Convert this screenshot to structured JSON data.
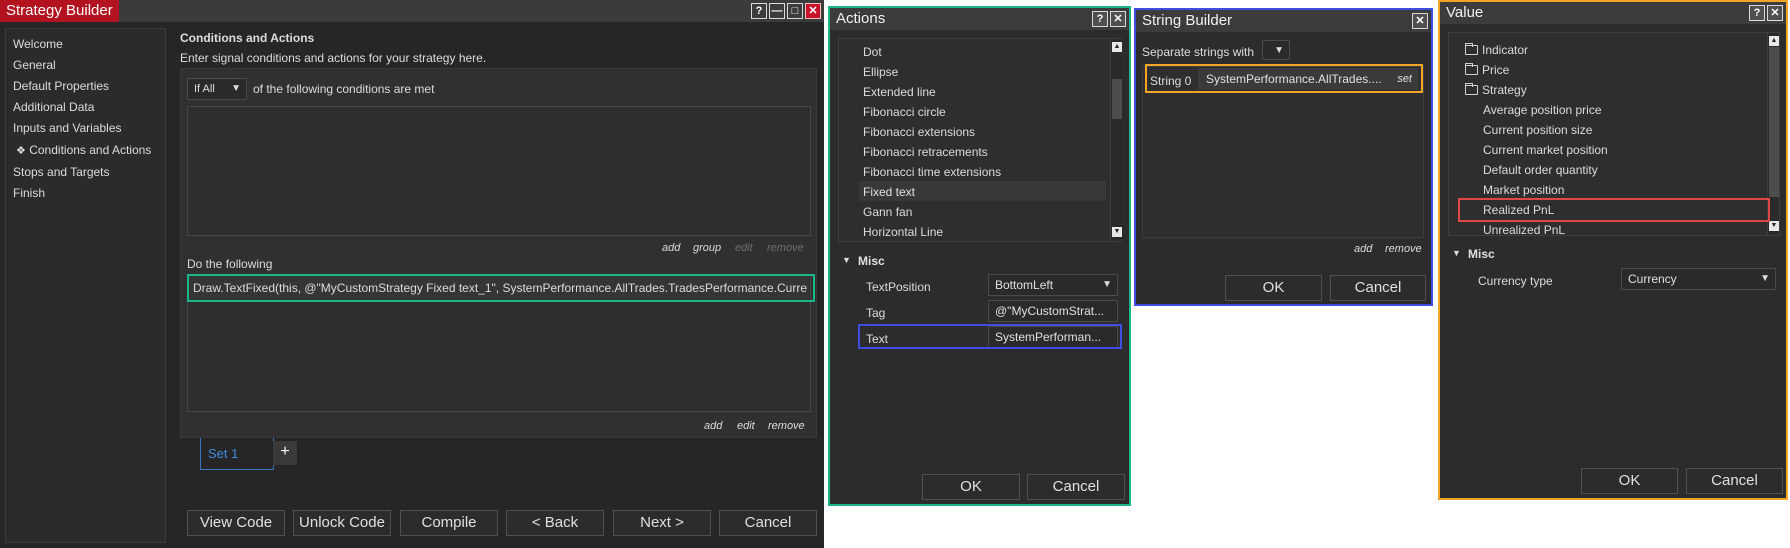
{
  "strategy_builder": {
    "title": "Strategy Builder",
    "help": "?",
    "minimize": "—",
    "maximize": "□",
    "close": "✕",
    "nav": [
      {
        "label": "Welcome"
      },
      {
        "label": "General"
      },
      {
        "label": "Default Properties"
      },
      {
        "label": "Additional Data"
      },
      {
        "label": "Inputs and Variables"
      },
      {
        "label": "Conditions and Actions",
        "selected_marker": "❖"
      },
      {
        "label": "Stops and Targets"
      },
      {
        "label": "Finish"
      }
    ],
    "section_title": "Conditions and Actions",
    "section_desc": "Enter signal conditions and actions for your strategy here.",
    "condition_select": "If All",
    "condition_text": "of the following conditions are met",
    "cond_links": {
      "add": "add",
      "group": "group",
      "edit": "edit",
      "remove": "remove"
    },
    "do_following": "Do the following",
    "action_line": "Draw.TextFixed(this, @\"MyCustomStrategy Fixed text_1\", SystemPerformance.AllTrades.TradesPerformance.Curre",
    "action_links": {
      "add": "add",
      "edit": "edit",
      "remove": "remove"
    },
    "set_tab": "Set 1",
    "add_set": "+",
    "buttons": {
      "view_code": "View Code",
      "unlock_code": "Unlock Code",
      "compile": "Compile",
      "back": "< Back",
      "next": "Next >",
      "cancel": "Cancel"
    }
  },
  "actions": {
    "title": "Actions",
    "help": "?",
    "close": "✕",
    "items": [
      "Dot",
      "Ellipse",
      "Extended line",
      "Fibonacci circle",
      "Fibonacci extensions",
      "Fibonacci retracements",
      "Fibonacci time extensions",
      "Fixed text",
      "Gann fan",
      "Horizontal Line"
    ],
    "misc_label": "Misc",
    "props": [
      {
        "name": "TextPosition",
        "value": "BottomLeft"
      },
      {
        "name": "Tag",
        "value": "@\"MyCustomStrat..."
      },
      {
        "name": "Text",
        "value": "SystemPerforman..."
      }
    ],
    "ok": "OK",
    "cancel": "Cancel"
  },
  "string_builder": {
    "title": "String Builder",
    "close": "✕",
    "separate_label": "Separate strings with",
    "string_label": "String 0",
    "string_value": "SystemPerformance.AllTrades....",
    "set_link": "set",
    "add": "add",
    "remove": "remove",
    "ok": "OK",
    "cancel": "Cancel"
  },
  "value": {
    "title": "Value",
    "help": "?",
    "close": "✕",
    "folders": [
      "Indicator",
      "Price",
      "Strategy"
    ],
    "items": [
      "Average position price",
      "Current position size",
      "Current market position",
      "Default order quantity",
      "Market position",
      "Realized PnL",
      "Unrealized PnL"
    ],
    "misc_label": "Misc",
    "currency_type_label": "Currency type",
    "currency_type_value": "Currency",
    "ok": "OK",
    "cancel": "Cancel"
  },
  "colors": {
    "accent_green": "#1ab589",
    "accent_blue": "#3d4fe3",
    "accent_orange": "#f2a526",
    "accent_red": "#e24747",
    "title_red": "#b3121f"
  }
}
